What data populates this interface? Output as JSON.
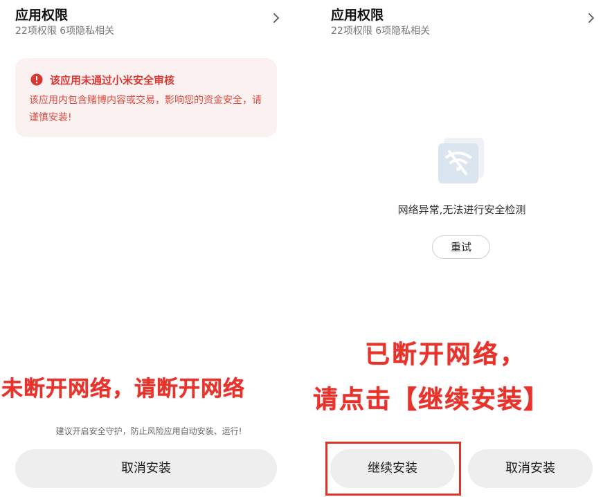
{
  "left_panel": {
    "header": {
      "title": "应用权限",
      "subtitle": "22项权限 6项隐私相关"
    },
    "warning": {
      "title": "该应用未通过小米安全审核",
      "body": "该应用内包含赌博内容或交易，影响您的资金安全，请谨慎安装!"
    },
    "annotation": "未断开网络，请断开网络",
    "hint": "建议开启安全守护，防止风险应用自动安装、运行!",
    "cancel_label": "取消安装"
  },
  "right_panel": {
    "header": {
      "title": "应用权限",
      "subtitle": "22项权限 6项隐私相关"
    },
    "network": {
      "message": "网络异常,无法进行安全检测",
      "retry_label": "重试"
    },
    "annotation_line1": "已断开网络，",
    "annotation_line2": "请点击【继续安装】",
    "continue_label": "继续安装",
    "cancel_label": "取消安装"
  },
  "colors": {
    "warning_text": "#d93832",
    "annotation_red": "#e8322a",
    "warning_bg": "#fbf1f1",
    "button_bg": "#eeeeee"
  },
  "icons": [
    "chevron-right-icon",
    "alert-circle-icon",
    "no-wifi-icon"
  ]
}
